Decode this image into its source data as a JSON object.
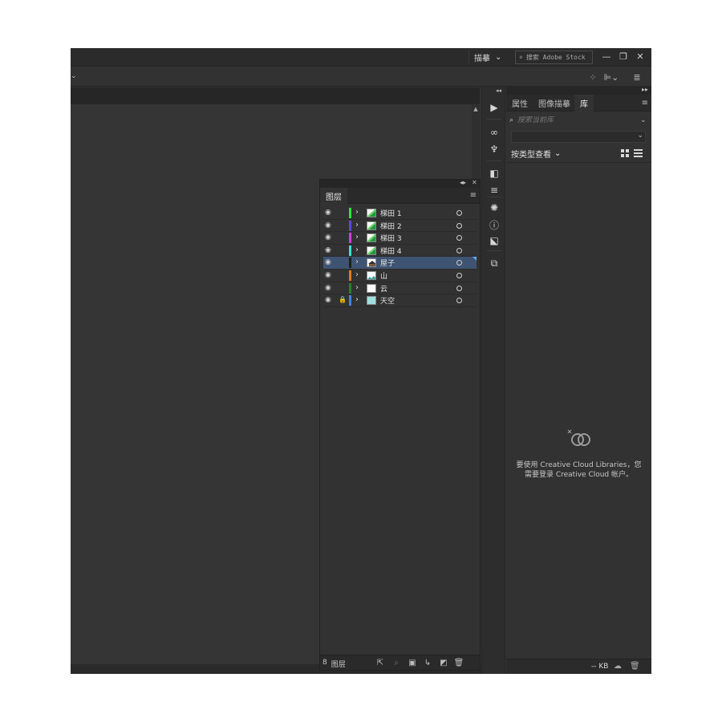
{
  "titlebar": {
    "workspace": "描摹",
    "stock_search_placeholder": "搜索 Adobe Stock",
    "icons": [
      "search-icon",
      "chevron-down-icon",
      "minimize-icon",
      "restore-icon",
      "close-icon"
    ]
  },
  "layers_panel": {
    "tab": "图层",
    "layer_count": "8",
    "count_label": "图层",
    "layers": [
      {
        "name": "梯田 1",
        "color": "#33e33d",
        "thumb": "terrace",
        "selected": false,
        "locked": false
      },
      {
        "name": "梯田 2",
        "color": "#5b4bd9",
        "thumb": "terrace",
        "selected": false,
        "locked": false
      },
      {
        "name": "梯田 3",
        "color": "#d23fd6",
        "thumb": "terrace",
        "selected": false,
        "locked": false
      },
      {
        "name": "梯田 4",
        "color": "#3fe0d0",
        "thumb": "terrace",
        "selected": false,
        "locked": false
      },
      {
        "name": "屋子",
        "color": "#1f1f1f",
        "thumb": "house",
        "selected": true,
        "locked": false
      },
      {
        "name": "山",
        "color": "#e07b20",
        "thumb": "mountain",
        "selected": false,
        "locked": false
      },
      {
        "name": "云",
        "color": "#2e7d32",
        "thumb": "blank",
        "selected": false,
        "locked": false
      },
      {
        "name": "天空",
        "color": "#4a7fe0",
        "thumb": "sky",
        "selected": false,
        "locked": true
      }
    ]
  },
  "libraries_panel": {
    "tabs": [
      "属性",
      "图像描摹",
      "库"
    ],
    "active_tab": "库",
    "search_placeholder": "搜索当前库",
    "view_by": "按类型查看",
    "empty_message_1": "要使用 Creative Cloud Libraries，您",
    "empty_message_2": "需要登录 Creative Cloud 帐户。",
    "storage": "-- KB"
  }
}
